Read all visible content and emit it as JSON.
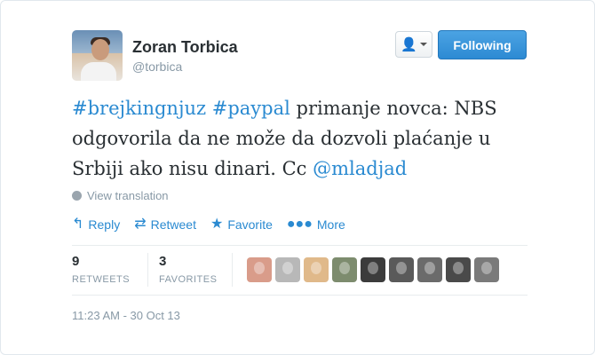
{
  "user": {
    "name": "Zoran Torbica",
    "handle": "@torbica"
  },
  "buttons": {
    "user_menu_icon": "person-icon",
    "follow_label": "Following",
    "follow_color": "#2d8ad3"
  },
  "tweet": {
    "hashtag1": "#brejkingnjuz",
    "hashtag2": "#paypal",
    "text_part1": "primanje novca: NBS odgovorila da ne može da dozvoli plaćanje u Srbiji ako nisu dinari. Cc",
    "mention": "@mladjad",
    "link_color": "#2a8ad1"
  },
  "translation_label": "View translation",
  "actions": {
    "reply": "Reply",
    "retweet": "Retweet",
    "favorite": "Favorite",
    "more": "More"
  },
  "stats": {
    "retweets_count": "9",
    "retweets_label": "RETWEETS",
    "favorites_count": "3",
    "favorites_label": "FAVORITES"
  },
  "favoriters": [
    {
      "color": "#d99c8a"
    },
    {
      "color": "#b8b8b8"
    },
    {
      "color": "#e0b98a"
    },
    {
      "color": "#7d8c6e"
    },
    {
      "color": "#3c3c3c"
    },
    {
      "color": "#5a5a5a"
    },
    {
      "color": "#6b6b6b"
    },
    {
      "color": "#4a4a4a"
    },
    {
      "color": "#7a7a7a"
    }
  ],
  "timestamp": "11:23 AM - 30 Oct 13"
}
